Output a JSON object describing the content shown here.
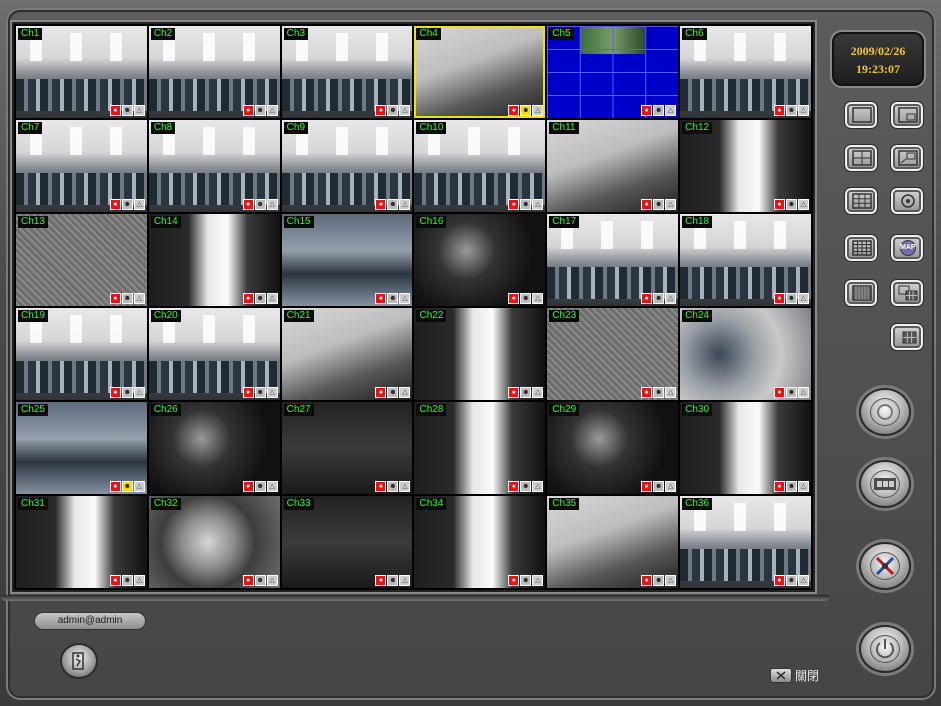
{
  "datetime": {
    "date": "2009/02/26",
    "time": "19:23:07"
  },
  "cameras": [
    {
      "label": "Ch1",
      "scene": "office",
      "motion_alert": false,
      "selected": false
    },
    {
      "label": "Ch2",
      "scene": "office",
      "motion_alert": false,
      "selected": false
    },
    {
      "label": "Ch3",
      "scene": "office",
      "motion_alert": false,
      "selected": false
    },
    {
      "label": "Ch4",
      "scene": "ceiling",
      "motion_alert": true,
      "selected": true
    },
    {
      "label": "Ch5",
      "scene": "multi",
      "motion_alert": false,
      "selected": false
    },
    {
      "label": "Ch6",
      "scene": "office",
      "motion_alert": false,
      "selected": false
    },
    {
      "label": "Ch7",
      "scene": "office",
      "motion_alert": false,
      "selected": false
    },
    {
      "label": "Ch8",
      "scene": "office",
      "motion_alert": false,
      "selected": false
    },
    {
      "label": "Ch9",
      "scene": "office",
      "motion_alert": false,
      "selected": false
    },
    {
      "label": "Ch10",
      "scene": "office",
      "motion_alert": false,
      "selected": false
    },
    {
      "label": "Ch11",
      "scene": "ceiling",
      "motion_alert": false,
      "selected": false
    },
    {
      "label": "Ch12",
      "scene": "corridor",
      "motion_alert": false,
      "selected": false
    },
    {
      "label": "Ch13",
      "scene": "noise",
      "motion_alert": false,
      "selected": false
    },
    {
      "label": "Ch14",
      "scene": "corridor",
      "motion_alert": false,
      "selected": false
    },
    {
      "label": "Ch15",
      "scene": "people",
      "motion_alert": false,
      "selected": false
    },
    {
      "label": "Ch16",
      "scene": "night",
      "motion_alert": false,
      "selected": false
    },
    {
      "label": "Ch17",
      "scene": "office",
      "motion_alert": false,
      "selected": false
    },
    {
      "label": "Ch18",
      "scene": "office",
      "motion_alert": false,
      "selected": false
    },
    {
      "label": "Ch19",
      "scene": "office",
      "motion_alert": false,
      "selected": false
    },
    {
      "label": "Ch20",
      "scene": "office",
      "motion_alert": false,
      "selected": false
    },
    {
      "label": "Ch21",
      "scene": "ceiling",
      "motion_alert": false,
      "selected": false
    },
    {
      "label": "Ch22",
      "scene": "corridor",
      "motion_alert": false,
      "selected": false
    },
    {
      "label": "Ch23",
      "scene": "noise",
      "motion_alert": false,
      "selected": false
    },
    {
      "label": "Ch24",
      "scene": "blur",
      "motion_alert": false,
      "selected": false
    },
    {
      "label": "Ch25",
      "scene": "people",
      "motion_alert": true,
      "selected": false
    },
    {
      "label": "Ch26",
      "scene": "night",
      "motion_alert": false,
      "selected": false
    },
    {
      "label": "Ch27",
      "scene": "dark",
      "motion_alert": false,
      "selected": false
    },
    {
      "label": "Ch28",
      "scene": "corridor",
      "motion_alert": false,
      "selected": false
    },
    {
      "label": "Ch29",
      "scene": "night",
      "motion_alert": false,
      "selected": false
    },
    {
      "label": "Ch30",
      "scene": "corridor",
      "motion_alert": false,
      "selected": false
    },
    {
      "label": "Ch31",
      "scene": "corridor",
      "motion_alert": false,
      "selected": false
    },
    {
      "label": "Ch32",
      "scene": "clock",
      "motion_alert": false,
      "selected": false
    },
    {
      "label": "Ch33",
      "scene": "dark",
      "motion_alert": false,
      "selected": false
    },
    {
      "label": "Ch34",
      "scene": "corridor",
      "motion_alert": false,
      "selected": false
    },
    {
      "label": "Ch35",
      "scene": "ceiling",
      "motion_alert": false,
      "selected": false
    },
    {
      "label": "Ch36",
      "scene": "office",
      "motion_alert": false,
      "selected": false
    }
  ],
  "cell_icons": [
    "record-icon",
    "motion-icon",
    "alarm-icon"
  ],
  "layout_buttons": [
    {
      "icon": "layout-1-icon"
    },
    {
      "icon": "layout-pip-icon"
    },
    {
      "icon": "layout-4-icon"
    },
    {
      "icon": "layout-pip2-icon"
    },
    {
      "icon": "layout-9-icon"
    },
    {
      "icon": "sequence-icon"
    },
    {
      "icon": "layout-16-icon"
    },
    {
      "icon": "map-icon",
      "text": "MAP"
    },
    {
      "icon": "layout-36-icon"
    },
    {
      "icon": "layout-13-icon"
    },
    {
      "icon": "layout-10-icon"
    }
  ],
  "round_buttons": [
    {
      "icon": "live-view-icon"
    },
    {
      "icon": "playback-film-icon"
    },
    {
      "icon": "settings-tools-icon"
    },
    {
      "icon": "power-icon"
    }
  ],
  "user": {
    "name": "admin@admin"
  },
  "close": {
    "label": "關閉"
  },
  "colors": {
    "label_green": "#29ff29",
    "record_red": "#e11111",
    "date_amber": "#f3c63a",
    "selected_yellow": "#f1e300"
  }
}
